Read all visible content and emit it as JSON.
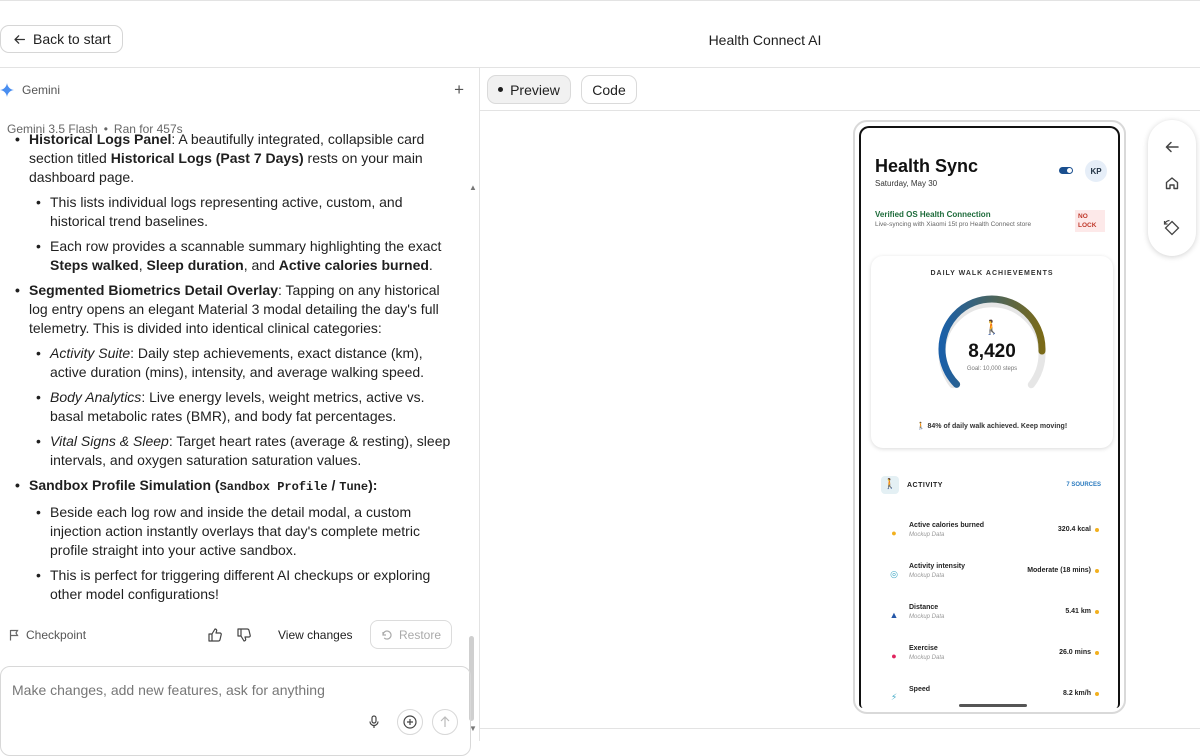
{
  "topbar": {
    "back_label": "Back to start",
    "app_title": "Health Connect AI"
  },
  "chat": {
    "agent_name": "Gemini",
    "model": "Gemini 3.5 Flash",
    "run_time": "Ran for 457s",
    "message": {
      "partial_line_1a": "Historical Logs Panel",
      "partial_line_1b": ": A beautifully integrated, collapsible card section titled ",
      "partial_line_1c": "Historical Logs (Past 7 Days)",
      "partial_line_1d": " rests on your main dashboard page.",
      "hl_sub1": "This lists individual logs representing active, custom, and historical trend baselines.",
      "hl_sub2a": "Each row provides a scannable summary highlighting the exact ",
      "hl_sub2b": "Steps walked",
      "hl_sub2c": ", ",
      "hl_sub2d": "Sleep duration",
      "hl_sub2e": ", and ",
      "hl_sub2f": "Active calories burned",
      "hl_sub2g": ".",
      "seg_title": "Segmented Biometrics Detail Overlay",
      "seg_body": ": Tapping on any historical log entry opens an elegant Material 3 modal detailing the day's full telemetry. This is divided into identical clinical categories:",
      "seg_sub1a": "Activity Suite",
      "seg_sub1b": ": Daily step achievements, exact distance (km), active duration (mins), intensity, and average walking speed.",
      "seg_sub2a": "Body Analytics",
      "seg_sub2b": ": Live energy levels, weight metrics, active vs. basal metabolic rates (BMR), and body fat percentages.",
      "seg_sub3a": "Vital Signs & Sleep",
      "seg_sub3b": ": Target heart rates (average & resting), sleep intervals, and oxygen saturation saturation values.",
      "sb_title": "Sandbox Profile Simulation (",
      "sb_code1": "Sandbox Profile",
      "sb_slash": " / ",
      "sb_code2": "Tune",
      "sb_end": "):",
      "sb_sub1": "Beside each log row and inside the detail modal, a custom injection action instantly overlays that day's complete metric profile straight into your active sandbox.",
      "sb_sub2": "This is perfect for triggering different AI checkups or exploring other model configurations!"
    },
    "actions": {
      "checkpoint": "Checkpoint",
      "view_changes": "View changes",
      "restore": "Restore"
    },
    "composer_placeholder": "Make changes, add new features, ask for anything"
  },
  "preview": {
    "tabs": {
      "preview": "Preview",
      "code": "Code"
    },
    "app": {
      "title": "Health Sync",
      "date": "Saturday, May 30",
      "avatar": "KP",
      "verify_title": "Verified OS Health Connection",
      "verify_sub": "Live-syncing with Xiaomi 15t pro Health Connect store",
      "no_lock": "NO LOCK",
      "card_title": "DAILY WALK ACHIEVEMENTS",
      "steps": "8,420",
      "goal": "Goal: 10,000 steps",
      "achievement": "🚶 84% of daily walk achieved. Keep moving!",
      "progress": 0.842,
      "activity_label": "ACTIVITY",
      "sources": "7 SOURCES",
      "metrics": [
        {
          "name": "Active calories burned",
          "sub": "Mockup Data",
          "value": "320.4 kcal",
          "icon": "flame-icon",
          "color": "#f2b01e"
        },
        {
          "name": "Activity intensity",
          "sub": "Mockup Data",
          "value": "Moderate (18 mins)",
          "icon": "intensity-icon",
          "color": "#3aa6c4"
        },
        {
          "name": "Distance",
          "sub": "Mockup Data",
          "value": "5.41 km",
          "icon": "distance-icon",
          "color": "#2456a8"
        },
        {
          "name": "Exercise",
          "sub": "Mockup Data",
          "value": "26.0 mins",
          "icon": "exercise-icon",
          "color": "#e0245e"
        },
        {
          "name": "Speed",
          "sub": "",
          "value": "8.2 km/h",
          "icon": "speed-icon",
          "color": "#3aa6c4"
        }
      ]
    }
  },
  "colors": {
    "accent_blue": "#1a5fa8",
    "gauge_gold": "#7a5a18",
    "sparkle": "#4a8ef0"
  }
}
